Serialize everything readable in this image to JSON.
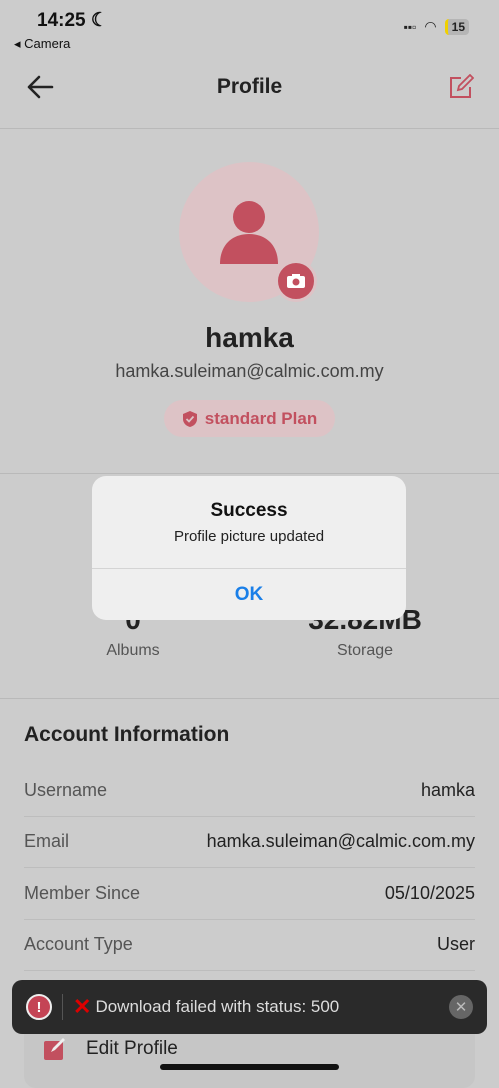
{
  "status_bar": {
    "time": "14:25",
    "back_app": "◂ Camera",
    "battery": "15"
  },
  "header": {
    "title": "Profile"
  },
  "profile": {
    "name": "hamka",
    "email": "hamka.suleiman@calmic.com.my",
    "plan": "standard Plan"
  },
  "stats": [
    {
      "value": "0",
      "label": "Albums"
    },
    {
      "value": "32.82MB",
      "label": "Storage"
    }
  ],
  "account": {
    "heading": "Account Information",
    "rows": [
      {
        "key": "Username",
        "value": "hamka"
      },
      {
        "key": "Email",
        "value": "hamka.suleiman@calmic.com.my"
      },
      {
        "key": "Member Since",
        "value": "05/10/2025"
      },
      {
        "key": "Account Type",
        "value": "User"
      }
    ]
  },
  "actions": {
    "edit_profile": "Edit Profile"
  },
  "dialog": {
    "title": "Success",
    "message": "Profile picture updated",
    "ok": "OK"
  },
  "toast": {
    "message": "Download failed with status: 500"
  },
  "colors": {
    "accent": "#c2505f",
    "link": "#1a7fe8"
  }
}
